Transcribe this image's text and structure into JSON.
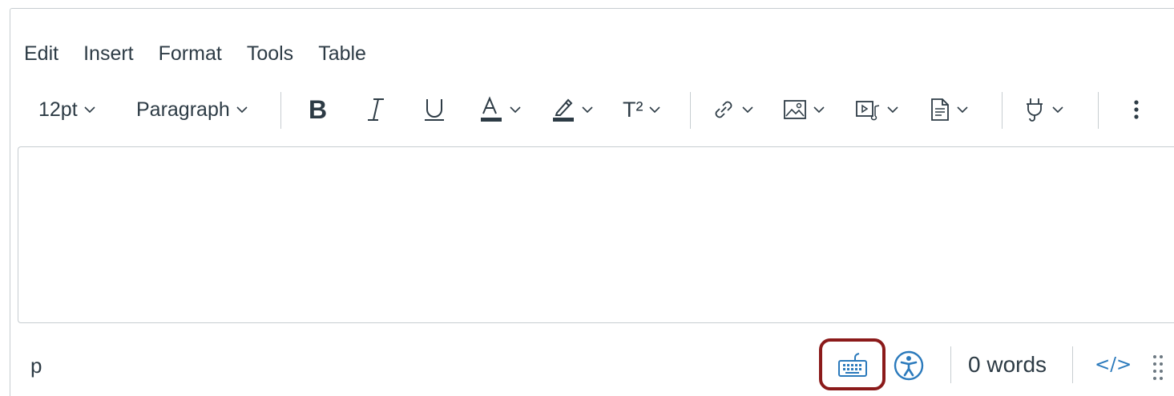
{
  "menubar": {
    "items": [
      "Edit",
      "Insert",
      "Format",
      "Tools",
      "Table"
    ]
  },
  "toolbar": {
    "font_size": "12pt",
    "block_format": "Paragraph",
    "bold_label": "B",
    "superscript_label": "T²",
    "icons": [
      "bold-icon",
      "italic-icon",
      "underline-icon",
      "text-color-icon",
      "highlight-color-icon",
      "superscript-icon",
      "link-icon",
      "image-icon",
      "media-icon",
      "document-icon",
      "plugin-icon",
      "more-options-icon"
    ]
  },
  "content": {
    "text": ""
  },
  "statusbar": {
    "path": "p",
    "word_count": "0 words",
    "html_toggle_label": "</>",
    "highlight_color": "#8b1a1a",
    "accent_color": "#2b7abc"
  }
}
